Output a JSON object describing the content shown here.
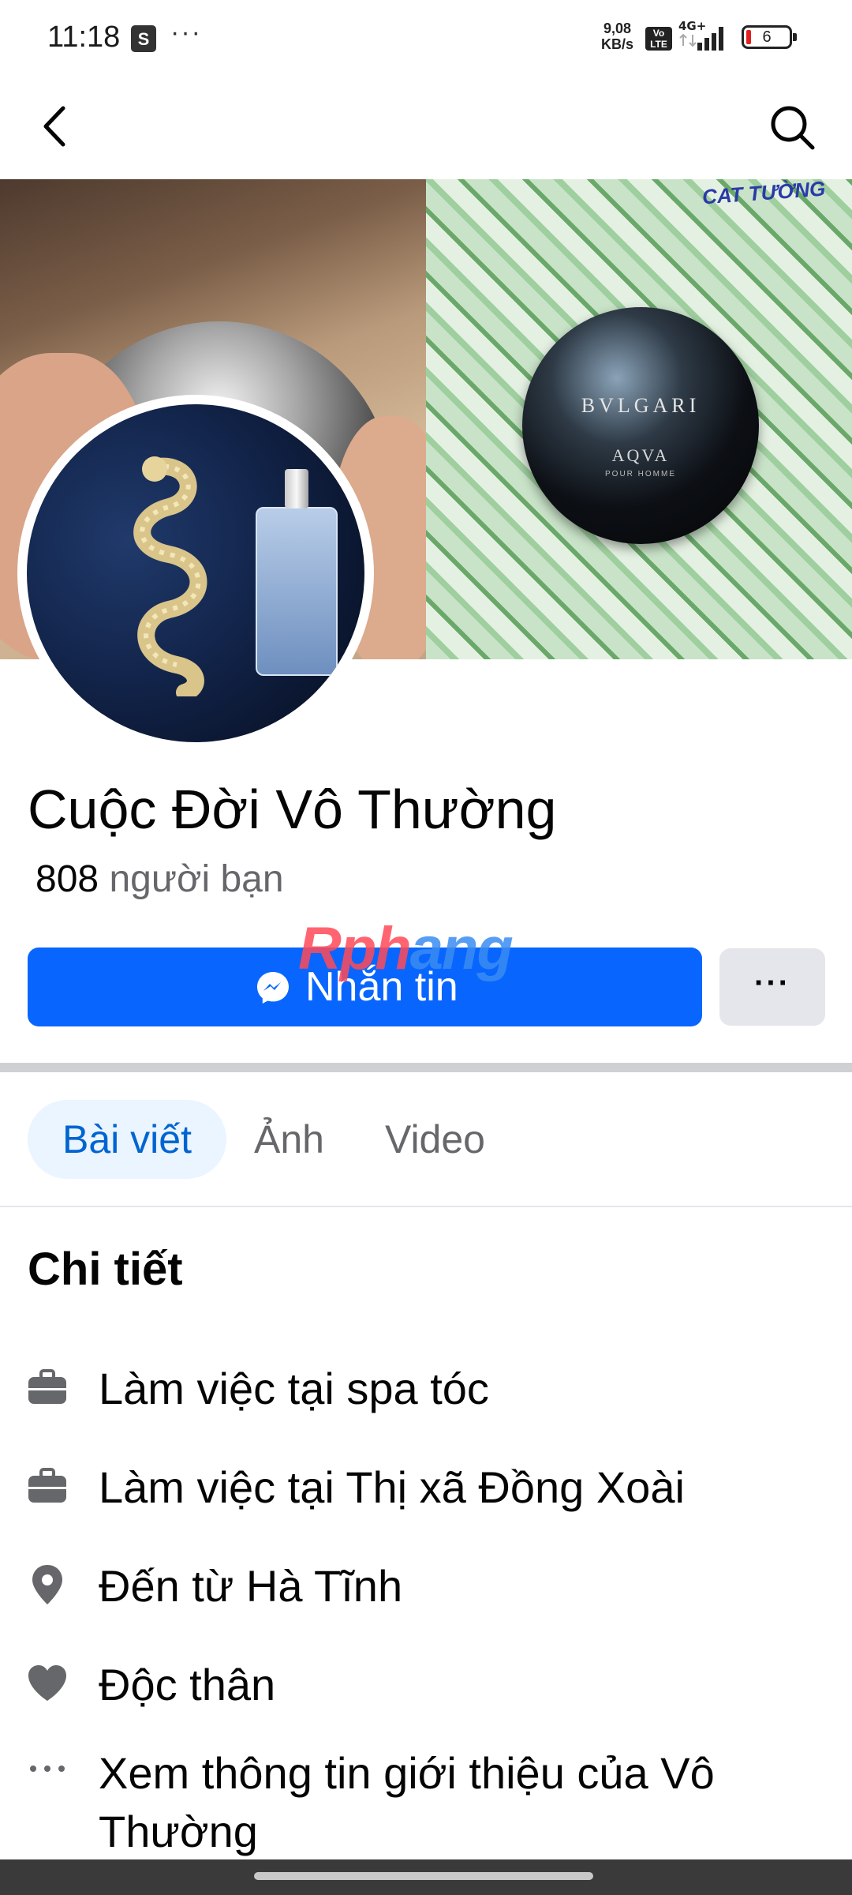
{
  "status_bar": {
    "time": "11:18",
    "shop_icon_glyph": "S",
    "more_dots": "···",
    "speed_value": "9,08",
    "speed_unit": "KB/s",
    "volte": "Vo LTE",
    "network": "4G+",
    "battery_level": "6"
  },
  "header": {
    "back_icon": "back-arrow-icon",
    "search_icon": "search-icon"
  },
  "cover": {
    "handwritten_tag": "CAT TƯỜNG",
    "perfume_brand": "BVLGARI",
    "perfume_model": "AQVA",
    "perfume_subline": "POUR HOMME"
  },
  "profile": {
    "name": "Cuộc Đời Vô Thường",
    "friends_count": "808",
    "friends_label": "người bạn"
  },
  "watermark": {
    "part1": "Rph",
    "part2": "ang"
  },
  "actions": {
    "message_label": "Nhắn tin",
    "more_label": "···"
  },
  "tabs": [
    {
      "label": "Bài viết",
      "active": true
    },
    {
      "label": "Ảnh",
      "active": false
    },
    {
      "label": "Video",
      "active": false
    }
  ],
  "details": {
    "title": "Chi tiết",
    "items": [
      {
        "icon": "briefcase-icon",
        "text": "Làm việc tại spa tóc"
      },
      {
        "icon": "briefcase-icon",
        "text": "Làm việc tại Thị xã Đồng Xoài"
      },
      {
        "icon": "location-pin-icon",
        "text": "Đến từ Hà Tĩnh"
      },
      {
        "icon": "heart-icon",
        "text": "Độc thân"
      },
      {
        "icon": "ellipsis-icon",
        "text": "Xem thông tin giới thiệu của Vô Thường"
      }
    ]
  },
  "colors": {
    "primary": "#0866ff",
    "tab_active_bg": "#ebf5ff",
    "tab_active_text": "#0064d1",
    "secondary_text": "#65676b",
    "button_grey": "#e4e6eb"
  }
}
